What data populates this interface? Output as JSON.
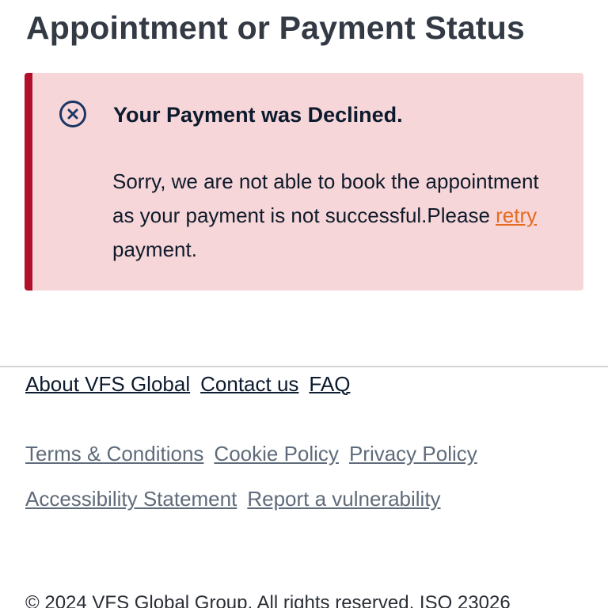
{
  "page": {
    "title": "Appointment or Payment Status"
  },
  "alert": {
    "icon": "close-circle-icon",
    "heading": "Your Payment was Declined.",
    "message_before": "Sorry, we are not able to book the appointment as your payment is not successful.Please ",
    "retry_link": "retry ",
    "message_after": "payment.",
    "colors": {
      "background": "#f7d6d9",
      "accent_bar": "#b0102a",
      "icon": "#1c3664",
      "link": "#e56b1f"
    }
  },
  "footer": {
    "primary_links": [
      "About VFS Global",
      "Contact us",
      "FAQ"
    ],
    "secondary_links": [
      [
        "Terms & Conditions",
        "Cookie Policy",
        "Privacy Policy"
      ],
      [
        "Accessibility Statement",
        "Report a vulnerability"
      ]
    ],
    "copyright": "© 2024 VFS Global Group. All rights reserved. ISO 23026"
  }
}
